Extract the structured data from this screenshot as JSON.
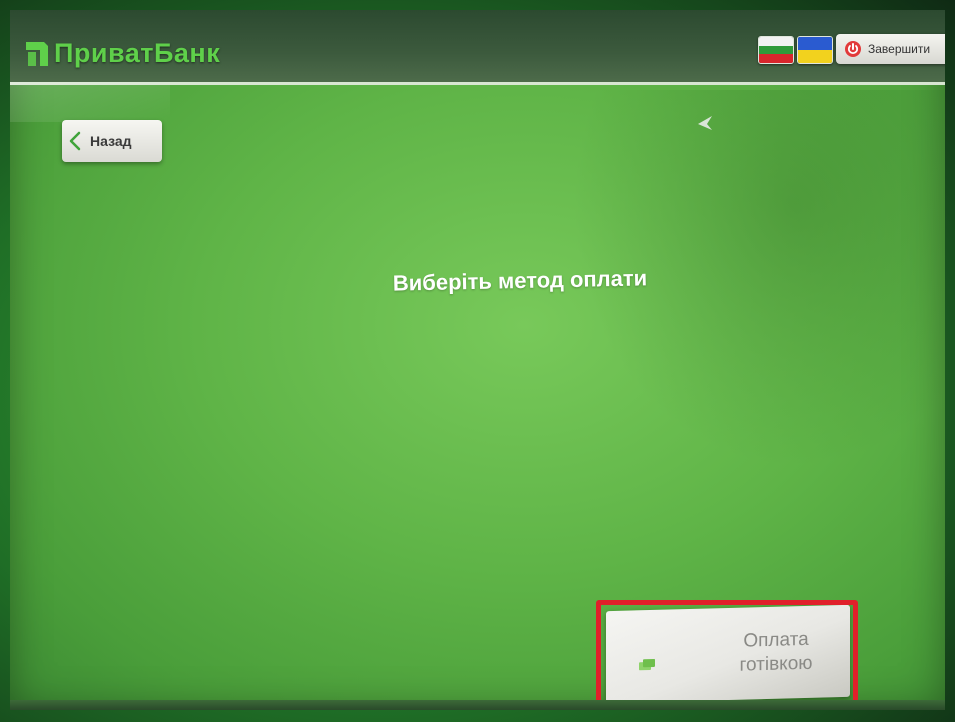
{
  "header": {
    "logo_text": "ПриватБанк",
    "exit_label": "Завершити",
    "languages": [
      "ru-flag-icon",
      "uk-flag-icon"
    ]
  },
  "nav": {
    "back_label": "Назад"
  },
  "main": {
    "title": "Виберіть метод оплати"
  },
  "payment_options": [
    {
      "label": "Оплата готівкою",
      "icon": "cash-icon"
    }
  ],
  "colors": {
    "screen_green": "#5fb447",
    "header_dark": "#2c4a30",
    "logo_green": "#5fd04a",
    "highlight_red": "#e0202a"
  }
}
